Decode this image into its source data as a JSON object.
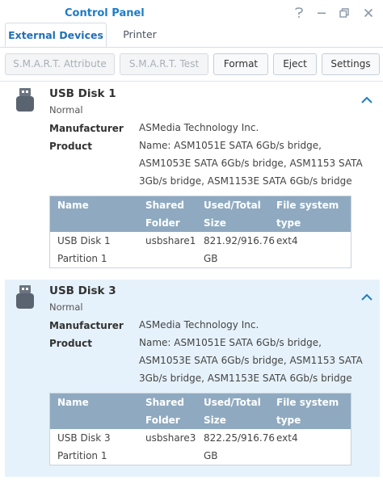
{
  "window": {
    "title": "Control Panel"
  },
  "tabs": [
    "External Devices",
    "Printer"
  ],
  "toolbar": {
    "smart_attribute": "S.M.A.R.T. Attribute",
    "smart_test": "S.M.A.R.T. Test",
    "format": "Format",
    "eject": "Eject",
    "settings": "Settings"
  },
  "labels": {
    "manufacturer": "Manufacturer",
    "product": "Product"
  },
  "table_headers": {
    "name": [
      "Name",
      ""
    ],
    "shared": [
      "Shared",
      "Folder"
    ],
    "used": [
      "Used/Total",
      "Size"
    ],
    "fs": [
      "File system",
      "type"
    ]
  },
  "disks": [
    {
      "name": "USB Disk 1",
      "status": "Normal",
      "manufacturer": "ASMedia Technology Inc.",
      "product_lines": [
        "Name: ASM1051E SATA 6Gb/s bridge,",
        "ASM1053E SATA 6Gb/s bridge, ASM1153 SATA",
        "3Gb/s bridge, ASM1153E SATA 6Gb/s bridge"
      ],
      "partition": {
        "name": [
          "USB Disk 1",
          "Partition 1"
        ],
        "shared_folder": "usbshare1",
        "used_total": [
          "821.92/916.76",
          "GB"
        ],
        "fs": "ext4"
      }
    },
    {
      "name": "USB Disk 3",
      "status": "Normal",
      "manufacturer": "ASMedia Technology Inc.",
      "product_lines": [
        "Name: ASM1051E SATA 6Gb/s bridge,",
        "ASM1053E SATA 6Gb/s bridge, ASM1153 SATA",
        "3Gb/s bridge, ASM1153E SATA 6Gb/s bridge"
      ],
      "partition": {
        "name": [
          "USB Disk 3",
          "Partition 1"
        ],
        "shared_folder": "usbshare3",
        "used_total": [
          "822.25/916.76",
          "GB"
        ],
        "fs": "ext4"
      }
    }
  ],
  "colors": {
    "accent": "#1e7cc7",
    "selected_bg": "#e6f2fb",
    "table_header_bg": "#8faac0"
  }
}
